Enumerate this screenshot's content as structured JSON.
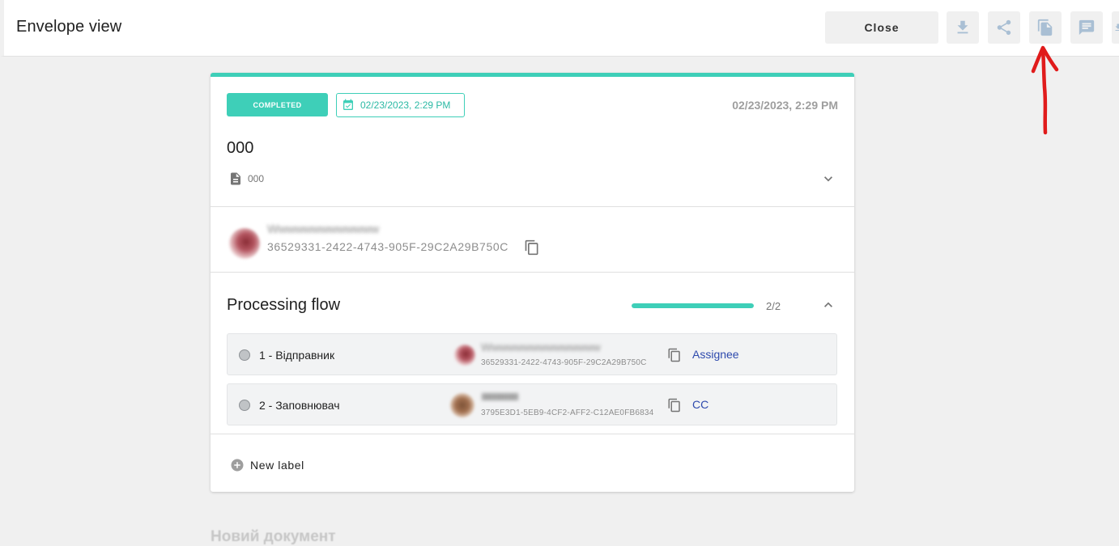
{
  "header": {
    "title": "Envelope view",
    "close_label": "Close",
    "actions": [
      "download-icon",
      "share-icon",
      "copy-document-icon",
      "comment-icon",
      "more-download-icon"
    ]
  },
  "envelope": {
    "status": "COMPLETED",
    "date_chip": "02/23/2023, 2:29 PM",
    "date_right": "02/23/2023, 2:29 PM",
    "title": "000",
    "file_name": "000"
  },
  "sender": {
    "id": "36529331-2422-4743-905F-29C2A29B750C",
    "name_blurred": "Wwwwwwwwwwwww"
  },
  "flow": {
    "title": "Processing flow",
    "progress_text": "2/2",
    "progress_fraction": 1.0,
    "steps": [
      {
        "name": "1 - Відправник",
        "id": "36529331-2422-4743-905F-29C2A29B750C",
        "name_blurred": "Wwwwwwwwwwwwwww",
        "role": "Assignee"
      },
      {
        "name": "2 - Заповнювач",
        "id": "3795E3D1-5EB9-4CF2-AFF2-C12AE0FB6834",
        "name_blurred": "IIIIIIIIIIIIIIIIIIIIIIIIIIII",
        "role": "CC"
      }
    ]
  },
  "new_label": "New label",
  "below_text": "Новий документ",
  "colors": {
    "accent": "#3ecfb8",
    "link": "#2e4aad",
    "annotation": "#e01b1b"
  }
}
